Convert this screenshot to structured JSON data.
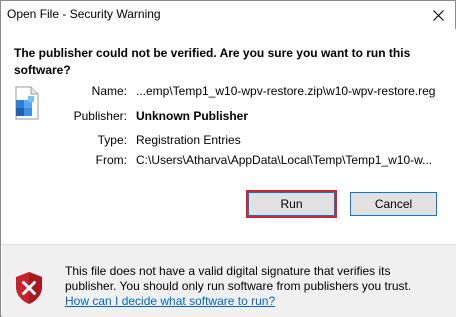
{
  "window": {
    "title": "Open File - Security Warning",
    "close_icon": "close-icon"
  },
  "main": {
    "question": "The publisher could not be verified.  Are you sure you want to run this software?",
    "file_icon": "registry-file-icon",
    "fields": [
      {
        "label": "Name:",
        "value": "...emp\\Temp1_w10-wpv-restore.zip\\w10-wpv-restore.reg"
      },
      {
        "label": "Publisher:",
        "value": "Unknown Publisher"
      },
      {
        "label": "Type:",
        "value": "Registration Entries"
      },
      {
        "label": "From:",
        "value": "C:\\Users\\Atharva\\AppData\\Local\\Temp\\Temp1_w10-w..."
      }
    ],
    "buttons": {
      "run": "Run",
      "cancel": "Cancel"
    }
  },
  "footer": {
    "shield_icon": "shield-x-icon",
    "warning": "This file does not have a valid digital signature that verifies its publisher.  You should only run software from publishers you trust.",
    "help_link": "How can I decide what software to run?"
  },
  "colors": {
    "link": "#0066cc",
    "focus_border": "#0078d7",
    "highlight": "#d9232b",
    "footer_bg": "#f0f0f0"
  }
}
